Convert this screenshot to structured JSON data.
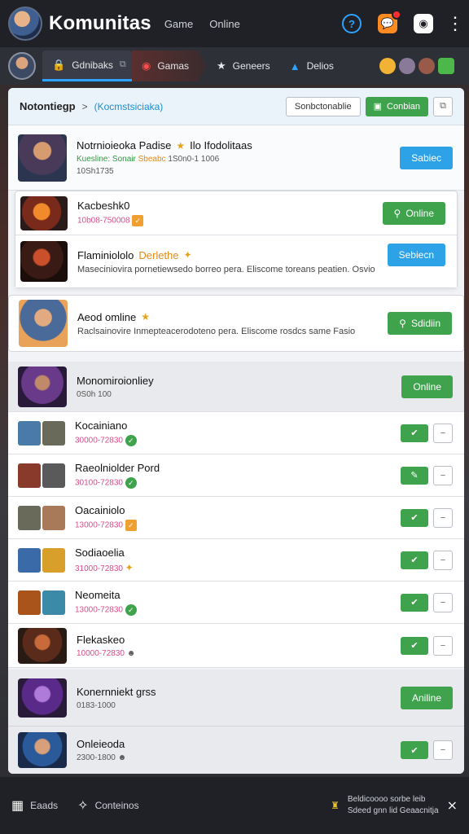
{
  "app": {
    "title": "Komunitas",
    "nav_links": [
      "Game",
      "Online"
    ]
  },
  "tabs": [
    {
      "label": "Gdnibaks",
      "active": true
    },
    {
      "label": "Gamas"
    },
    {
      "label": "Geneers"
    },
    {
      "label": "Delios"
    }
  ],
  "panel": {
    "breadcrumb": "Notontiegp",
    "breadcrumb_sub": "(Kocmstsiciaka)",
    "outline_button": "Sonbctonablie",
    "green_button": "Conbian"
  },
  "featured": {
    "name": "Notrnioieoka Padise",
    "name_suffix": "Ilo Ifodolitaas",
    "meta_green": "Kuesline: Sonair",
    "meta_orange": "Sbeabc",
    "meta_rest": "1S0n0-1 1006",
    "meta2": "10Sh1735",
    "button": "Sabiec"
  },
  "expanded_rows": [
    {
      "name": "Kacbeshk0",
      "meta": "10b08-750008"
    },
    {
      "name": "Flaminiololo",
      "name_highlight": "Derlethe",
      "desc": "Maseciniovira pornetiewsedo borreo pera. Eliscome toreans peatien. Osvio",
      "button": "Sebiecn"
    }
  ],
  "online_row": {
    "name": "Aeod omline",
    "desc": "Raclsainovire Inmepteacerodoteno pera. Eliscome rosdcs same Fasio",
    "button": "Sdidiin"
  },
  "status_row": {
    "name": "Monomiroionliey",
    "meta": "0S0h 100",
    "button": "Online"
  },
  "list": [
    {
      "name": "Kocainiano",
      "meta": "30000-72830"
    },
    {
      "name": "Raeolniolder Pord",
      "meta": "30100-72830"
    },
    {
      "name": "Oacainiolo",
      "meta": "13000-72830"
    },
    {
      "name": "Sodiaoelia",
      "meta": "31000-72830"
    },
    {
      "name": "Neomeita",
      "meta": "13000-72830"
    },
    {
      "name": "Flekaskeo",
      "meta": "10000-72830"
    }
  ],
  "bottom_rows": [
    {
      "name": "Konernniekt grss",
      "meta": "0183-1000",
      "button": "Aniline"
    },
    {
      "name": "Onleieoda",
      "meta": "2300-1800"
    }
  ],
  "bottombar": {
    "items": [
      "Eaads",
      "Conteinos"
    ],
    "right_line1": "Beldicoooo sorbe leib",
    "right_line2": "Sdeed gnn lid Geaacnitja"
  }
}
